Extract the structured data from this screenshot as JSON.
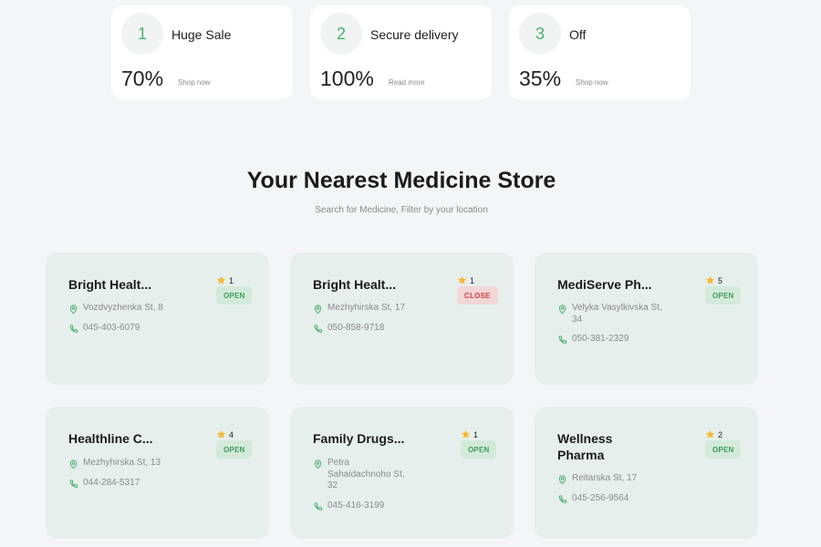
{
  "promos": [
    {
      "number": "1",
      "title": "Huge Sale",
      "value": "70%",
      "link": "Shop now"
    },
    {
      "number": "2",
      "title": "Secure delivery",
      "value": "100%",
      "link": "Read more"
    },
    {
      "number": "3",
      "title": "Off",
      "value": "35%",
      "link": "Shop now"
    }
  ],
  "section": {
    "title": "Your Nearest Medicine Store",
    "subtitle": "Search for Medicine, Filter by your location"
  },
  "stores": [
    {
      "name": "Bright Healt...",
      "rating": "1",
      "status": "OPEN",
      "address": "Vozdvyzhenka St, 8",
      "phone": "045-403-6079"
    },
    {
      "name": "Bright Healt...",
      "rating": "1",
      "status": "CLOSE",
      "address": "Mezhyhirska St, 17",
      "phone": "050-858-9718"
    },
    {
      "name": "MediServe Ph...",
      "rating": "5",
      "status": "OPEN",
      "address": "Velyka Vasylkivska St, 34",
      "phone": "050-381-2329"
    },
    {
      "name": "Healthline C...",
      "rating": "4",
      "status": "OPEN",
      "address": "Mezhyhirska St, 13",
      "phone": "044-284-5317"
    },
    {
      "name": "Family Drugs...",
      "rating": "1",
      "status": "OPEN",
      "address": "Petra Sahaidachnoho St, 32",
      "phone": "045-416-3199"
    },
    {
      "name": "Wellness Pharma",
      "rating": "2",
      "status": "OPEN",
      "address": "Reitarska St, 17",
      "phone": "045-256-9564"
    }
  ],
  "colors": {
    "accent_green": "#4caf73",
    "card_background": "#e6efeb",
    "open_badge": "#d3eadb",
    "close_badge": "#f3d6d6",
    "star": "#f6b935"
  },
  "icons": {
    "rating": "star-icon",
    "address": "map-pin-icon",
    "phone": "phone-icon"
  }
}
